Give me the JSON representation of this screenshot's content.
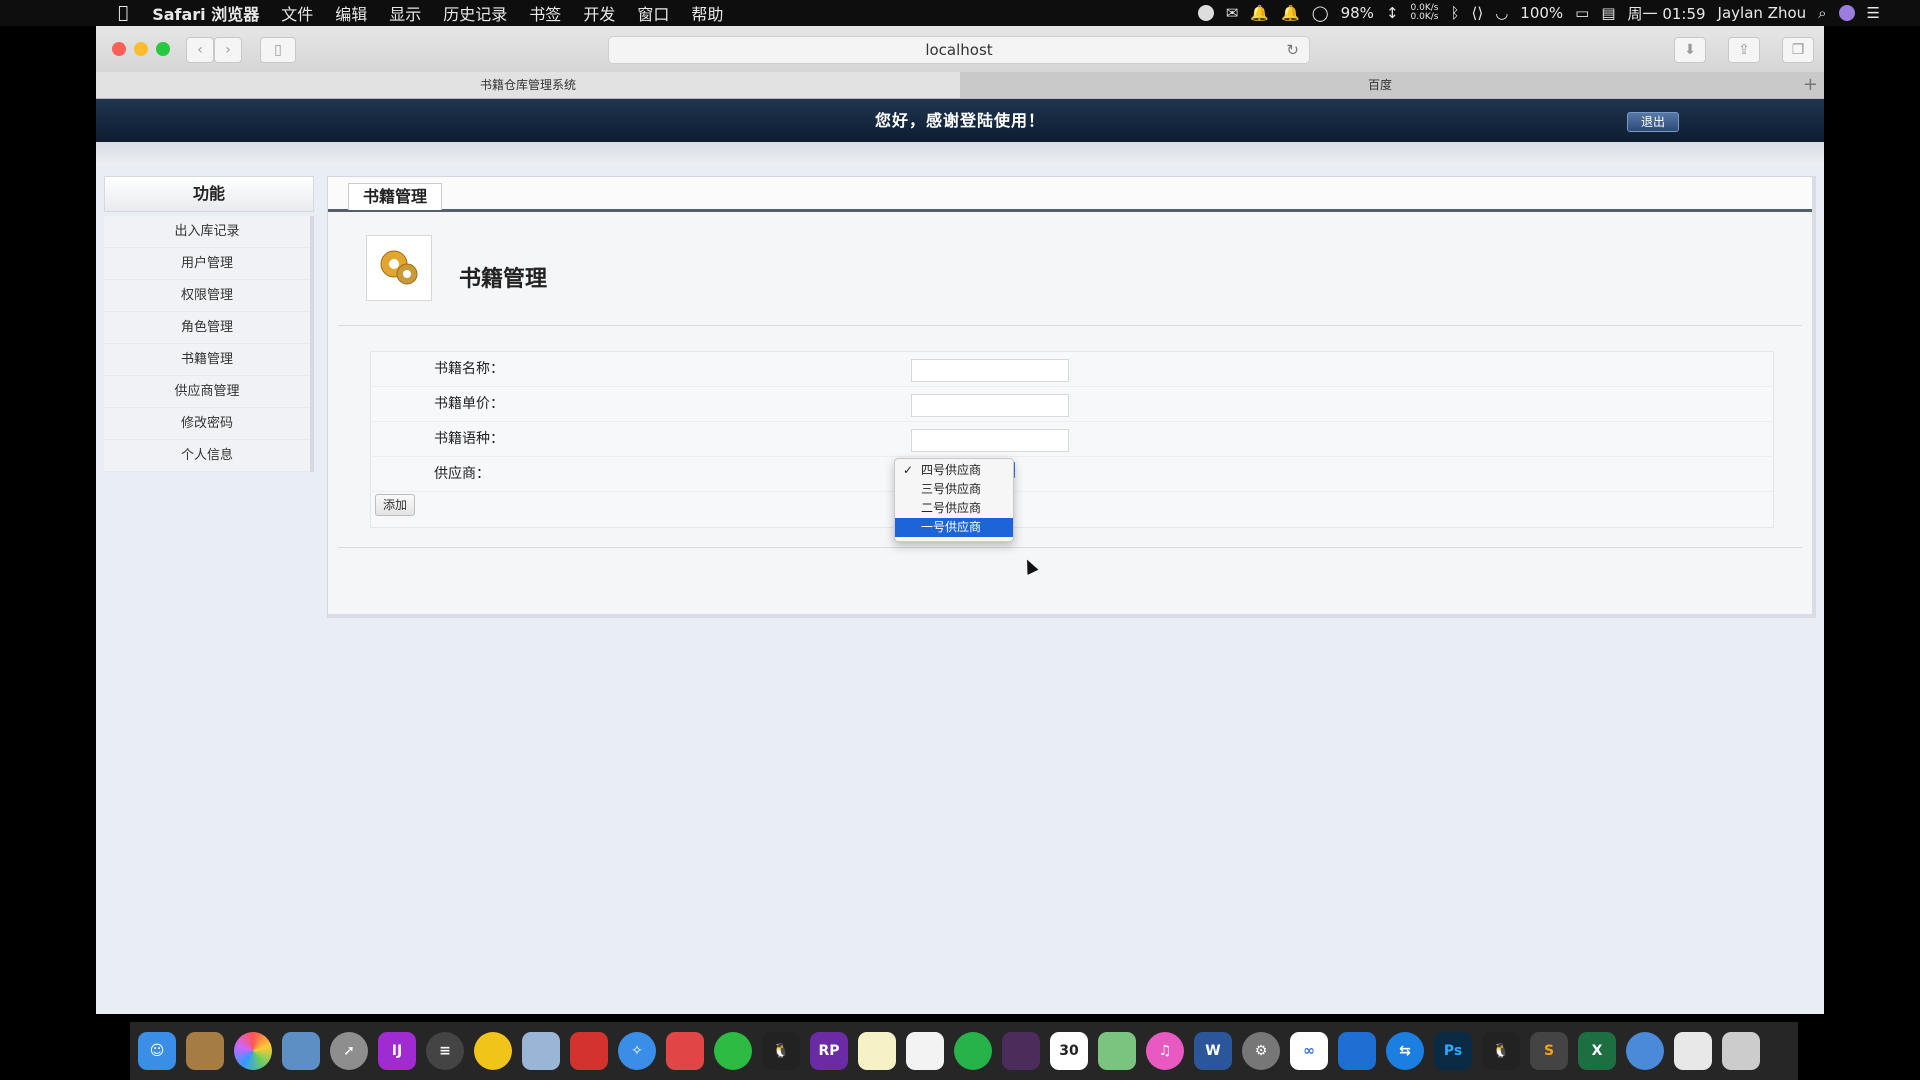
{
  "menubar": {
    "apple": "",
    "app_name": "Safari 浏览器",
    "menus": [
      "文件",
      "编辑",
      "显示",
      "历史记录",
      "书签",
      "开发",
      "窗口",
      "帮助"
    ],
    "battery_percent": "98%",
    "net_up": "0.0K/s",
    "net_down": "0.0K/s",
    "battery_level": "100%",
    "datetime": "周一 01:59",
    "user": "Jaylan Zhou"
  },
  "browser": {
    "url": "localhost",
    "tabs": [
      {
        "label": "书籍仓库管理系统"
      },
      {
        "label": "百度"
      }
    ],
    "new_tab": "+"
  },
  "banner": {
    "welcome": "您好，感谢登陆使用！",
    "logout": "退出"
  },
  "sidebar": {
    "title": "功能",
    "items": [
      "出入库记录",
      "用户管理",
      "权限管理",
      "角色管理",
      "书籍管理",
      "供应商管理",
      "修改密码",
      "个人信息"
    ]
  },
  "main": {
    "tab_label": "书籍管理",
    "page_title": "书籍管理",
    "form": {
      "name_label": "书籍名称：",
      "name_value": "",
      "price_label": "书籍单价：",
      "price_value": "",
      "language_label": "书籍语种：",
      "language_value": "",
      "supplier_label": "供应商：",
      "add_button": "添加"
    },
    "supplier_options": [
      "四号供应商",
      "三号供应商",
      "二号供应商",
      "一号供应商"
    ],
    "supplier_checked": "四号供应商",
    "supplier_highlighted": "一号供应商"
  },
  "colors": {
    "banner": "#1a2f49",
    "highlight": "#1d64d8",
    "close": "#fc5f57",
    "minimize": "#fdbc2e",
    "maximize": "#28c840"
  },
  "dock": {
    "apps": [
      "finder-icon",
      "notes-icon",
      "photos-icon",
      "preview-icon",
      "launchpad-icon",
      "intellij-icon",
      "sublime-icon",
      "squirrel-icon",
      "database-icon",
      "redis-icon",
      "safari-icon",
      "screenshot-icon",
      "wechat-icon",
      "qq-icon",
      "axure-icon",
      "stickies-icon",
      "notes2-icon",
      "qqmusic-icon",
      "jprofiler-icon",
      "calendar-icon",
      "maps-icon",
      "itunes-icon",
      "word-icon",
      "settings-icon",
      "baidunetdisk-icon",
      "teamviewer-icon",
      "teamviewer2-icon",
      "photoshop-icon",
      "qq2-icon",
      "sublime2-icon",
      "excel-icon",
      "chrome-icon",
      "documents-icon",
      "trash-icon"
    ],
    "calendar_day": "30",
    "axure_label": "RP",
    "ps_label": "Ps"
  }
}
